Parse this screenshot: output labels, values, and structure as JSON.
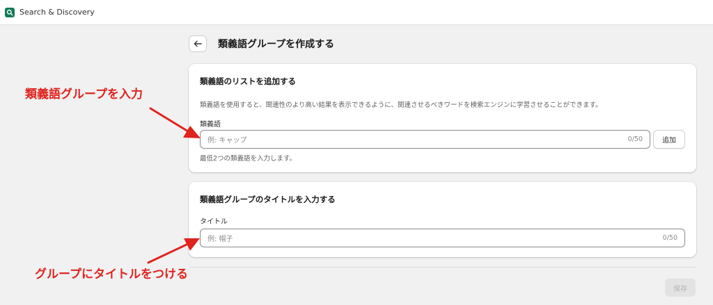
{
  "app": {
    "name": "Search & Discovery",
    "icon": "search-discovery-app-icon"
  },
  "header": {
    "title": "類義語グループを作成する",
    "back_icon": "arrow-left-icon"
  },
  "synonyms_card": {
    "title": "類義語のリストを追加する",
    "description": "類義語を使用すると、関連性のより高い結果を表示できるように、関連させるべきワードを検索エンジンに学習させることができます。",
    "field_label": "類義語",
    "placeholder": "例: キャップ",
    "counter": "0/50",
    "add_label": "追加",
    "help_text": "最低2つの類義語を入力します。"
  },
  "title_card": {
    "title": "類義語グループのタイトルを入力する",
    "field_label": "タイトル",
    "placeholder": "例: 帽子",
    "counter": "0/50"
  },
  "footer": {
    "save_label": "保存"
  },
  "annotations": {
    "synonym_note": "類義語グループを入力",
    "title_note": "グループにタイトルをつける",
    "color": "#e0231f"
  },
  "colors": {
    "brand": "#0f7a55",
    "background": "#f1f1f1",
    "card": "#ffffff"
  }
}
